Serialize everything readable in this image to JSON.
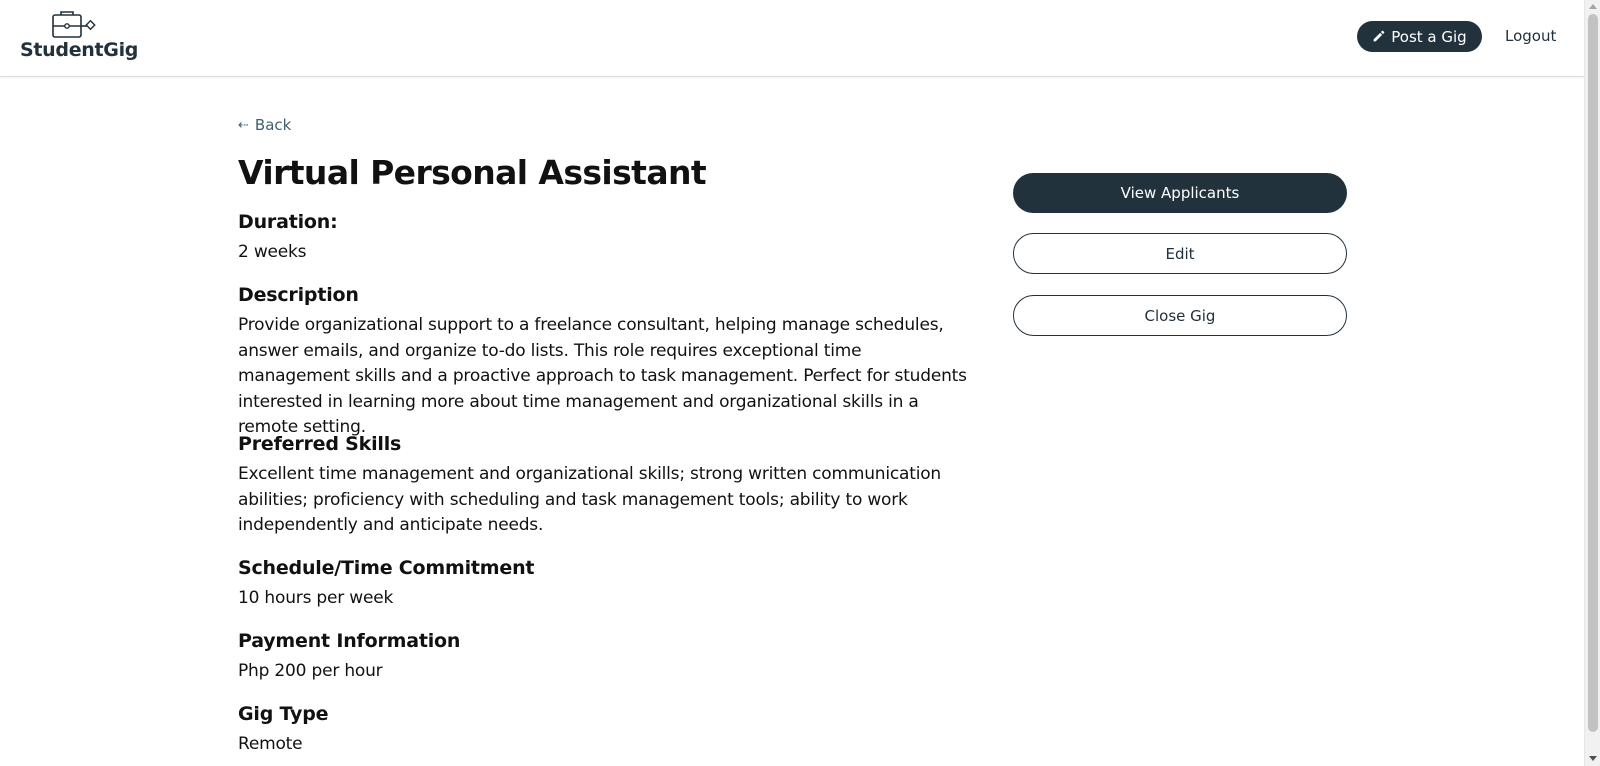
{
  "header": {
    "brand": "StudentGig",
    "post_gig_label": "Post a Gig",
    "logout_label": "Logout"
  },
  "nav": {
    "back_label": "Back"
  },
  "gig": {
    "title": "Virtual Personal Assistant",
    "duration_label": "Duration:",
    "duration": "2 weeks",
    "description_label": "Description",
    "description": "Provide organizational support to a freelance consultant, helping manage schedules, answer emails, and organize to-do lists. This role requires exceptional time management skills and a proactive approach to task management. Perfect for students interested in learning more about time management and organizational skills in a remote setting.",
    "skills_label": "Preferred Skills",
    "skills": "Excellent time management and organizational skills; strong written communication abilities; proficiency with scheduling and task management tools; ability to work independently and anticipate needs.",
    "schedule_label": "Schedule/Time Commitment",
    "schedule": "10 hours per week",
    "payment_label": "Payment Information",
    "payment": "Php 200 per hour",
    "type_label": "Gig Type",
    "type": "Remote"
  },
  "actions": {
    "view_applicants_label": "View Applicants",
    "edit_label": "Edit",
    "close_gig_label": "Close Gig"
  },
  "colors": {
    "brand_dark": "#22323d",
    "link": "#3f6070"
  },
  "icons": [
    "briefcase-logo-icon",
    "pencil-icon",
    "arrow-left-icon"
  ]
}
